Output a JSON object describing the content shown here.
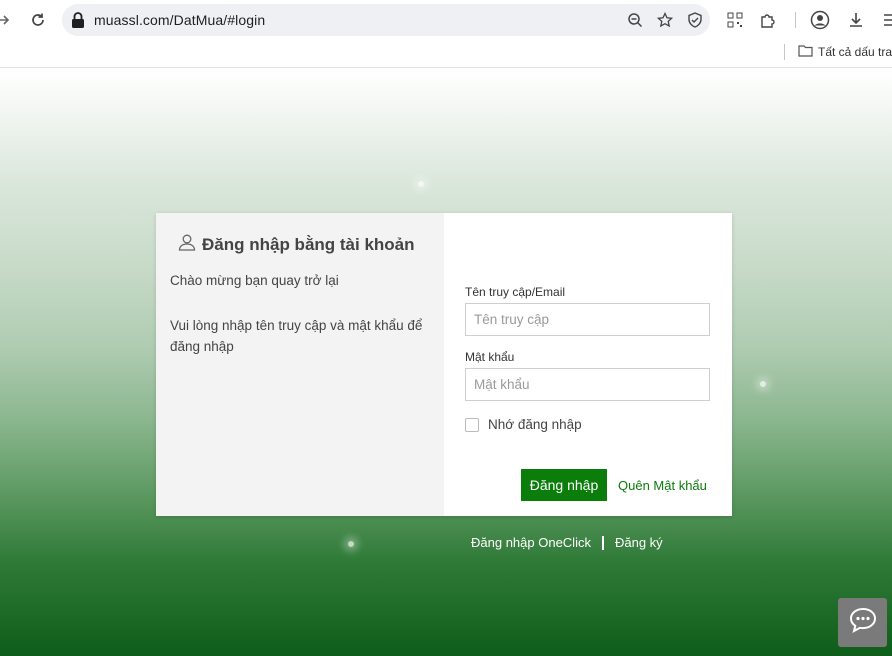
{
  "browser": {
    "url": "muassl.com/DatMua/#login",
    "bookmarks_folder": "Tất cả dấu trang"
  },
  "login": {
    "title": "Đăng nhập bằng tài khoản",
    "welcome": "Chào mừng bạn quay trở lại",
    "hint": "Vui lòng nhập tên truy cập và mật khẩu để đăng nhập",
    "username_label": "Tên truy cập/Email",
    "username_placeholder": "Tên truy cập",
    "password_label": "Mật khẩu",
    "password_placeholder": "Mật khẩu",
    "remember_label": "Nhớ đăng nhập",
    "login_button": "Đăng nhập",
    "forgot_link": "Quên Mật khẩu"
  },
  "links": {
    "oneclick": "Đăng nhập OneClick",
    "register": "Đăng ký"
  },
  "colors": {
    "accent": "#0a7d0a",
    "card_left_bg": "#f3f3f3",
    "chat_button": "#7a7a7a"
  },
  "icons": {
    "back": "arrow-right-icon",
    "reload": "reload-icon",
    "lock": "lock-icon",
    "zoom": "zoom-out-icon",
    "bookmark": "star-icon",
    "shield": "shield-icon",
    "qr": "qr-code-icon",
    "extensions": "puzzle-icon",
    "profile": "profile-icon",
    "download": "download-icon",
    "menu": "menu-icon",
    "folder": "folder-icon",
    "user": "user-icon",
    "chat": "chat-icon"
  }
}
